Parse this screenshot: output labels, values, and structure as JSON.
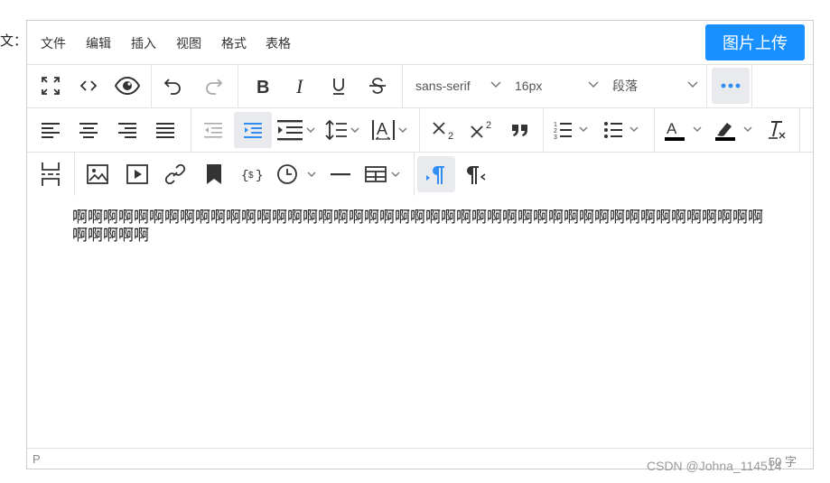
{
  "page": {
    "label": "文：",
    "content": "啊啊啊啊啊啊啊啊啊啊啊啊啊啊啊啊啊啊啊啊啊啊啊啊啊啊啊啊啊啊啊啊啊啊啊啊啊啊啊啊啊啊啊啊啊啊啊啊啊啊"
  },
  "menubar": {
    "items": [
      "文件",
      "编辑",
      "插入",
      "视图",
      "格式",
      "表格"
    ],
    "upload_label": "图片上传"
  },
  "toolbar": {
    "font_family": "sans-serif",
    "font_size": "16px",
    "block_format": "段落"
  },
  "statusbar": {
    "path": "P",
    "word_count": "50 字"
  },
  "watermark": "CSDN @Johna_114514",
  "colors": {
    "accent": "#1890ff",
    "active_icon": "#2f8df4"
  },
  "icons": [
    "fullscreen-icon",
    "code-icon",
    "preview-icon",
    "undo-icon",
    "redo-icon",
    "bold-icon",
    "italic-icon",
    "underline-icon",
    "strikethrough-icon",
    "more-icon",
    "align-left-icon",
    "align-center-icon",
    "align-right-icon",
    "align-justify-icon",
    "outdent-icon",
    "indent-icon",
    "line-height-icon",
    "paragraph-spacing-icon",
    "letter-spacing-icon",
    "subscript-icon",
    "superscript-icon",
    "blockquote-icon",
    "numbered-list-icon",
    "bullet-list-icon",
    "text-color-icon",
    "highlight-icon",
    "clear-format-icon",
    "page-break-icon",
    "image-icon",
    "media-icon",
    "link-icon",
    "bookmark-icon",
    "template-icon",
    "datetime-icon",
    "horizontal-rule-icon",
    "table-icon",
    "ltr-icon",
    "rtl-icon"
  ]
}
